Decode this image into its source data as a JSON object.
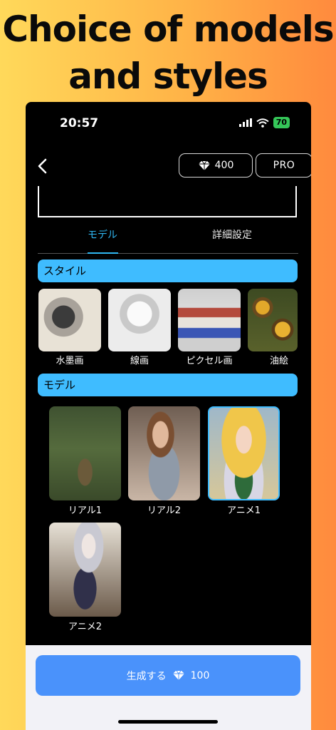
{
  "promo": {
    "line1": "Choice of models",
    "line2": "and styles"
  },
  "status_bar": {
    "time": "20:57",
    "battery": "70"
  },
  "header": {
    "credits": "400",
    "pro_label": "PRO"
  },
  "tabs": [
    {
      "label": "モデル",
      "active": true
    },
    {
      "label": "詳細設定",
      "active": false
    }
  ],
  "style_section": {
    "title": "スタイル",
    "items": [
      {
        "label": "水墨画"
      },
      {
        "label": "線画"
      },
      {
        "label": "ピクセル画"
      },
      {
        "label": "油絵"
      }
    ]
  },
  "model_section": {
    "title": "モデル",
    "items": [
      {
        "label": "リアル1",
        "selected": false
      },
      {
        "label": "リアル2",
        "selected": false
      },
      {
        "label": "アニメ1",
        "selected": true
      },
      {
        "label": "アニメ2",
        "selected": false
      }
    ]
  },
  "footer": {
    "generate_label": "生成する",
    "cost": "100"
  },
  "colors": {
    "accent": "#2fb7f2",
    "section_bar": "#3fbcff",
    "button": "#4a92fb"
  }
}
